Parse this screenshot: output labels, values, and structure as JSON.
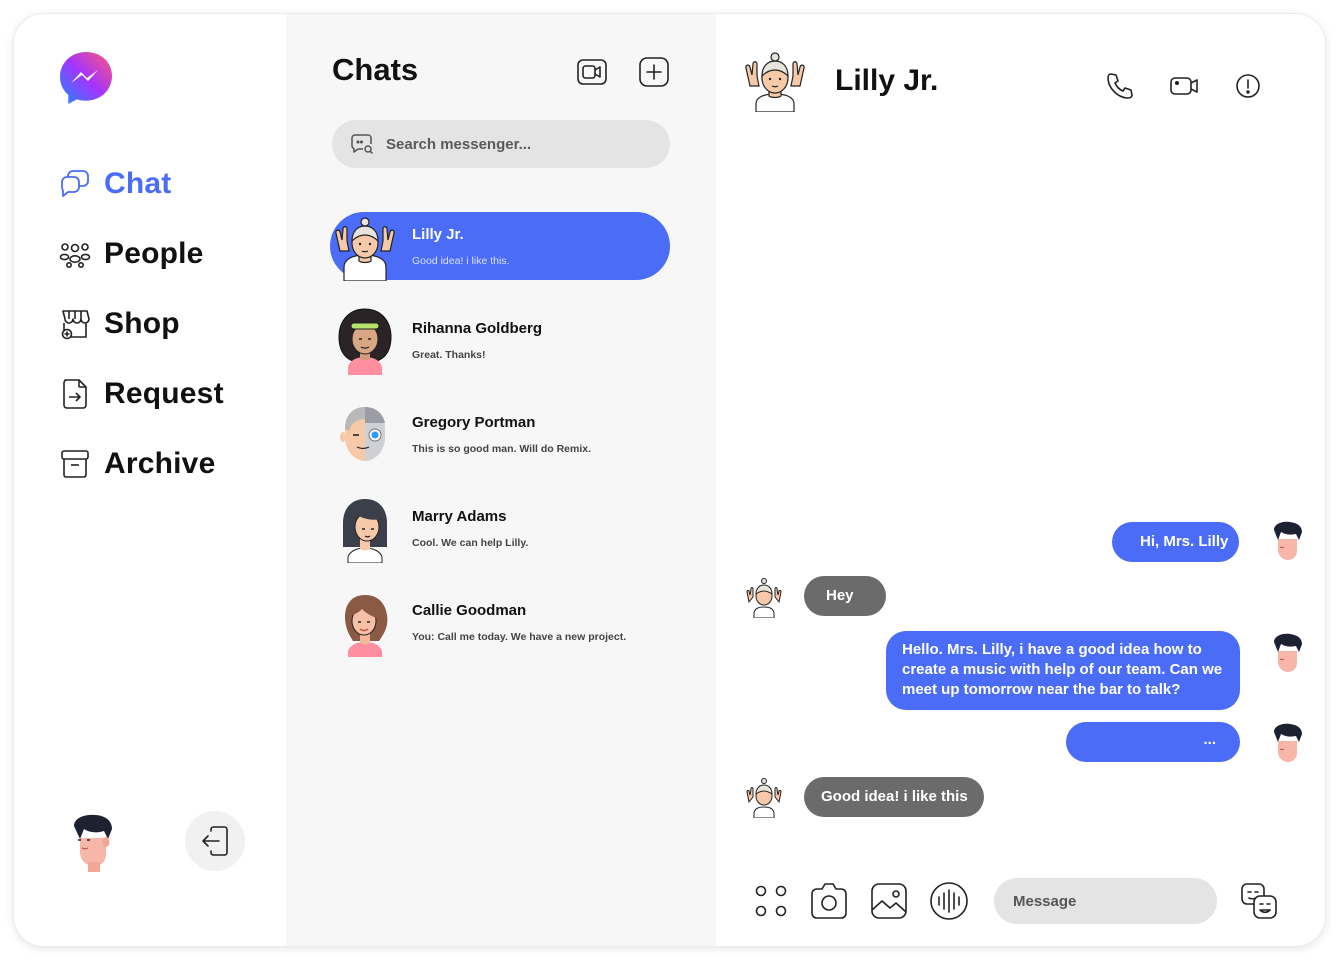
{
  "nav": {
    "items": [
      {
        "label": "Chat",
        "icon": "chat-bubbles-icon",
        "active": true
      },
      {
        "label": "People",
        "icon": "people-icon",
        "active": false
      },
      {
        "label": "Shop",
        "icon": "shop-icon",
        "active": false
      },
      {
        "label": "Request",
        "icon": "request-icon",
        "active": false
      },
      {
        "label": "Archive",
        "icon": "archive-icon",
        "active": false
      }
    ]
  },
  "list": {
    "title": "Chats",
    "search_placeholder": "Search messenger...",
    "conversations": [
      {
        "name": "Lilly Jr.",
        "preview": "Good idea! i like this.",
        "active": true
      },
      {
        "name": "Rihanna Goldberg",
        "preview": "Great. Thanks!",
        "active": false
      },
      {
        "name": "Gregory Portman",
        "preview": "This is so good man. Will do Remix.",
        "active": false
      },
      {
        "name": "Marry Adams",
        "preview": "Cool. We can help Lilly.",
        "active": false
      },
      {
        "name": "Callie Goodman",
        "preview": "You: Call me today. We have a new project.",
        "active": false
      }
    ]
  },
  "chat": {
    "contact_name": "Lilly Jr.",
    "messages": [
      {
        "from": "me",
        "text": "Hi, Mrs. Lilly"
      },
      {
        "from": "them",
        "text": "Hey"
      },
      {
        "from": "me",
        "text": "Hello. Mrs. Lilly, i have a good idea how to create a music with help of our team. Can we meet up tomorrow near the bar to talk?"
      },
      {
        "from": "me",
        "text": "..."
      },
      {
        "from": "them",
        "text": "Good idea! i like this"
      }
    ],
    "composer_placeholder": "Message"
  },
  "colors": {
    "accent": "#4a6cf7",
    "incoming_bubble": "#6b6b6b",
    "list_bg": "#f7f7f7",
    "search_bg": "#e4e4e4"
  }
}
